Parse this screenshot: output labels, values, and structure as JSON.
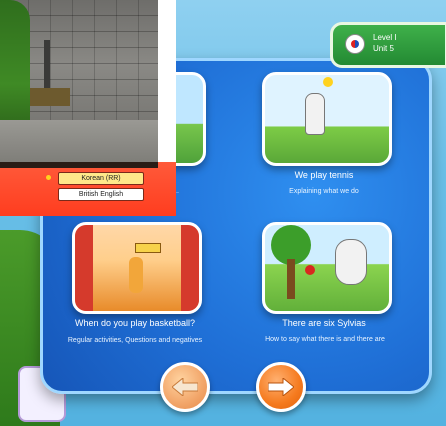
{
  "header": {
    "level_label": "Level  I",
    "unit_label": "Unit  5"
  },
  "lessons": [
    {
      "title": "",
      "subtitle": "..."
    },
    {
      "title": "We play tennis",
      "subtitle": "Explaining what we do"
    },
    {
      "title": "When do you play basketball?",
      "subtitle": "Regular activities, Questions and negatives"
    },
    {
      "title": "There are six Sylvias",
      "subtitle": "How to say what there is and there are"
    }
  ],
  "language_options": [
    {
      "label": "Korean (RR)",
      "selected": true
    },
    {
      "label": "British English",
      "selected": false
    }
  ],
  "icons": {
    "prev": "arrow-left-icon",
    "next": "arrow-right-icon",
    "flag": "uk-flag-icon"
  },
  "colors": {
    "panel_blue": "#1f6fd6",
    "badge_green": "#2f9c3e",
    "overlay_red": "#ff3d1f",
    "next_orange": "#f57a1e"
  }
}
